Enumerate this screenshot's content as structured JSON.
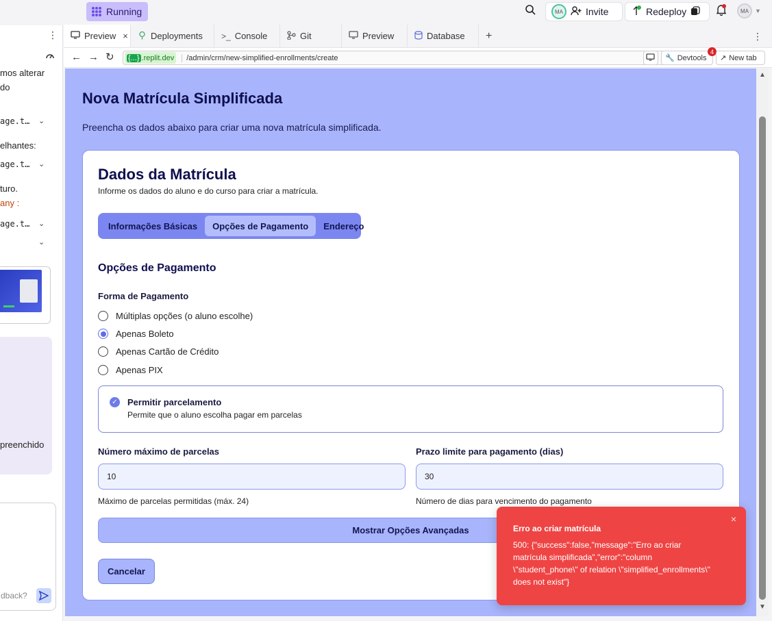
{
  "topbar": {
    "status_label": "Running",
    "invite_label": "Invite",
    "redeploy_label": "Redeploy",
    "avatar_initials": "MA",
    "profile_initials": "MA"
  },
  "left_panel": {
    "lines": [
      {
        "text": "mos alterar",
        "mono": false
      },
      {
        "text": "do",
        "mono": false
      },
      {
        "text": "age.t…",
        "mono": true
      },
      {
        "text": "elhantes:",
        "mono": false
      },
      {
        "text": "age.t…",
        "mono": true
      },
      {
        "text": "turo.",
        "mono": false
      },
      {
        "text": "any :",
        "mono": false
      },
      {
        "text": "age.t…",
        "mono": true
      }
    ],
    "preenchido_text": "preenchido",
    "feedback_placeholder": "dback?"
  },
  "tabs": [
    {
      "label": "Preview",
      "icon": "monitor-icon",
      "active": true
    },
    {
      "label": "Deployments",
      "icon": "deploy-icon",
      "active": false
    },
    {
      "label": "Console",
      "icon": "terminal-icon",
      "active": false
    },
    {
      "label": "Git",
      "icon": "git-icon",
      "active": false
    },
    {
      "label": "Preview",
      "icon": "monitor-icon",
      "active": false
    },
    {
      "label": "Database",
      "icon": "database-icon",
      "active": false
    }
  ],
  "url_bar": {
    "domain_chip": "{...}",
    "domain": ".replit.dev",
    "path": "/admin/crm/new-simplified-enrollments/create",
    "devtools_label": "Devtools",
    "devtools_badge": "4",
    "newtab_label": "New tab"
  },
  "page": {
    "title": "Nova Matrícula Simplificada",
    "subtitle": "Preencha os dados abaixo para criar uma nova matrícula simplificada.",
    "card_title": "Dados da Matrícula",
    "card_subtitle": "Informe os dados do aluno e do curso para criar a matrícula.",
    "steps": [
      {
        "label": "Informações Básicas",
        "active": false
      },
      {
        "label": "Opções de Pagamento",
        "active": true
      },
      {
        "label": "Endereço",
        "active": false
      }
    ],
    "section_title": "Opções de Pagamento",
    "payment_label": "Forma de Pagamento",
    "payment_options": [
      {
        "label": "Múltiplas opções (o aluno escolhe)",
        "checked": false
      },
      {
        "label": "Apenas Boleto",
        "checked": true
      },
      {
        "label": "Apenas Cartão de Crédito",
        "checked": false
      },
      {
        "label": "Apenas PIX",
        "checked": false
      }
    ],
    "installments_toggle": {
      "title": "Permitir parcelamento",
      "description": "Permite que o aluno escolha pagar em parcelas",
      "checked": true
    },
    "max_installments": {
      "label": "Número máximo de parcelas",
      "value": "10",
      "help": "Máximo de parcelas permitidas (máx. 24)"
    },
    "payment_deadline": {
      "label": "Prazo limite para pagamento (dias)",
      "value": "30",
      "help": "Número de dias para vencimento do pagamento"
    },
    "advanced_button": "Mostrar Opções Avançadas",
    "cancel_button": "Cancelar"
  },
  "toast": {
    "title": "Erro ao criar matrícula",
    "message": "500: {\"success\":false,\"message\":\"Erro ao criar matrícula simplificada\",\"error\":\"column \\\"student_phone\\\" of relation \\\"simplified_enrollments\\\" does not exist\"}",
    "close_label": "×"
  },
  "colors": {
    "accent": "#7b86f0",
    "content_bg": "#a8b4fb",
    "toast_bg": "#ef4444"
  }
}
